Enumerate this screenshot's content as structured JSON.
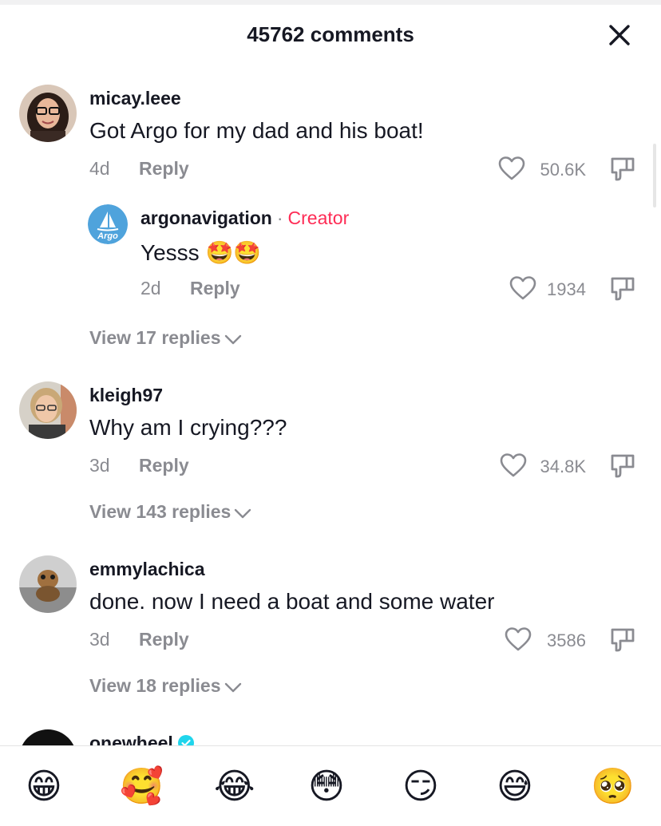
{
  "header": {
    "title": "45762 comments"
  },
  "comments": [
    {
      "username": "micay.leee",
      "text": "Got Argo for my dad and his boat!",
      "age": "4d",
      "reply_label": "Reply",
      "likes": "50.6K",
      "reply": {
        "username": "argonavigation",
        "separator": "·",
        "badge": "Creator",
        "avatar_text": "Argo",
        "text": "Yesss 🤩🤩",
        "age": "2d",
        "reply_label": "Reply",
        "likes": "1934"
      },
      "view_replies": "View 17 replies"
    },
    {
      "username": "kleigh97",
      "text": "Why am I crying???",
      "age": "3d",
      "reply_label": "Reply",
      "likes": "34.8K",
      "view_replies": "View 143 replies"
    },
    {
      "username": "emmylachica",
      "text": "done. now I need a boat and some water",
      "age": "3d",
      "reply_label": "Reply",
      "likes": "3586",
      "view_replies": "View 18 replies"
    },
    {
      "username": "onewheel"
    }
  ],
  "emoji_bar": [
    "😁",
    "🥰",
    "😂",
    "😳",
    "😏",
    "😅",
    "🥺"
  ],
  "colors": {
    "creator": "#fe2c55",
    "verified": "#20d5ec",
    "muted": "#8a8b91",
    "argo_blue": "#4fa3dc"
  }
}
